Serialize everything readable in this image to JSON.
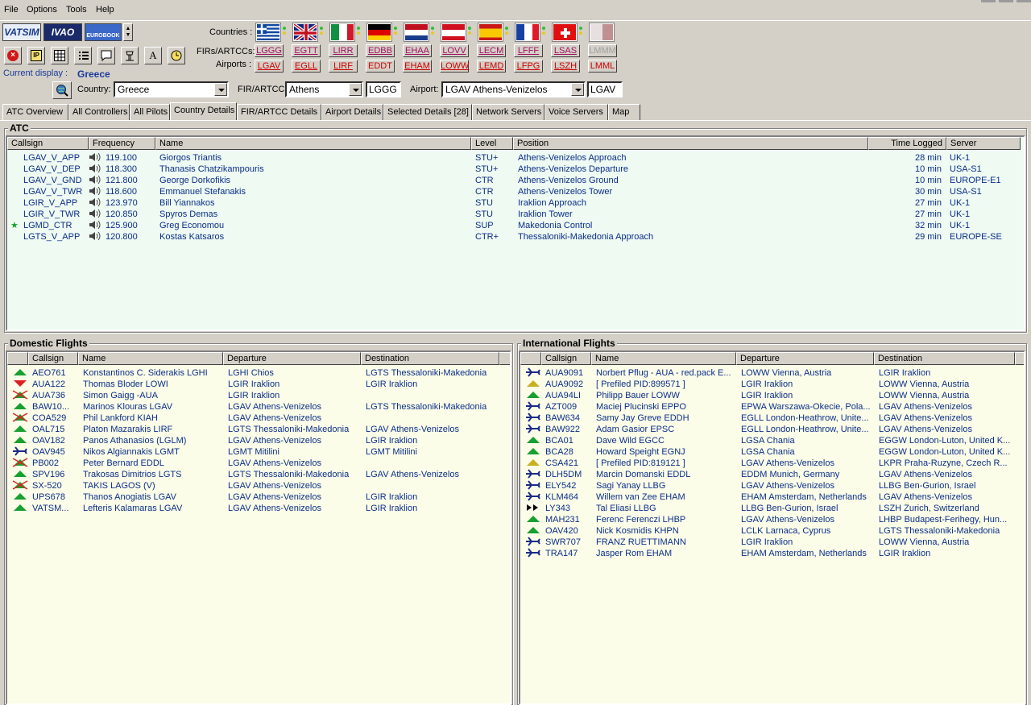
{
  "menu": [
    "File",
    "Options",
    "Tools",
    "Help"
  ],
  "logos": {
    "vatsim": "VATSIM",
    "ivao": "IVAO",
    "eurobook": "EUROBOOK"
  },
  "labels": {
    "countries": "Countries :",
    "firs": "FIRs/ARTCCs:",
    "airports": "Airports :",
    "current_display": "Current display :",
    "current_value": "Greece",
    "country": "Country:",
    "fir": "FIR/ARTCC:",
    "airport": "Airport:"
  },
  "firs": [
    "LGGG",
    "EGTT",
    "LIRR",
    "EDBB",
    "EHAA",
    "LOVV",
    "LECM",
    "LFFF",
    "LSAS",
    "LMMM"
  ],
  "airports": [
    "LGAV",
    "EGLL",
    "LIRF",
    "EDDT",
    "EHAM",
    "LOWW",
    "LEMD",
    "LFPG",
    "LSZH",
    "LMML"
  ],
  "selectors": {
    "country": "Greece",
    "fir": "Athens",
    "fir_code": "LGGG",
    "airport": "LGAV Athens-Venizelos",
    "airport_code": "LGAV"
  },
  "tabs": [
    "ATC Overview",
    "All Controllers",
    "All Pilots",
    "Country Details",
    "FIR/ARTCC Details",
    "Airport Details",
    "Selected Details [28]",
    "Network Servers",
    "Voice Servers",
    "Map"
  ],
  "atc": {
    "title": "ATC",
    "headers": [
      "Callsign",
      "Frequency",
      "Name",
      "Level",
      "Position",
      "Time Logged",
      "Server"
    ],
    "rows": [
      {
        "star": "",
        "callsign": "LGAV_V_APP",
        "freq": "119.100",
        "name": "Giorgos Triantis",
        "level": "STU+",
        "position": "Athens-Venizelos Approach",
        "time": "28 min",
        "server": "UK-1"
      },
      {
        "star": "",
        "callsign": "LGAV_V_DEP",
        "freq": "118.300",
        "name": "Thanasis Chatzikampouris",
        "level": "STU+",
        "position": "Athens-Venizelos Departure",
        "time": "10 min",
        "server": "USA-S1"
      },
      {
        "star": "",
        "callsign": "LGAV_V_GND",
        "freq": "121.800",
        "name": "George Dorkofikis",
        "level": "CTR",
        "position": "Athens-Venizelos Ground",
        "time": "10 min",
        "server": "EUROPE-E1"
      },
      {
        "star": "",
        "callsign": "LGAV_V_TWR",
        "freq": "118.600",
        "name": "Emmanuel Stefanakis",
        "level": "CTR",
        "position": "Athens-Venizelos Tower",
        "time": "30 min",
        "server": "USA-S1"
      },
      {
        "star": "",
        "callsign": "LGIR_V_APP",
        "freq": "123.970",
        "name": "Bill Yiannakos",
        "level": "STU",
        "position": "Iraklion Approach",
        "time": "27 min",
        "server": "UK-1"
      },
      {
        "star": "",
        "callsign": "LGIR_V_TWR",
        "freq": "120.850",
        "name": "Spyros Demas",
        "level": "STU",
        "position": "Iraklion Tower",
        "time": "27 min",
        "server": "UK-1"
      },
      {
        "star": "★",
        "callsign": "LGMD_CTR",
        "freq": "125.900",
        "name": "Greg Economou",
        "level": "SUP",
        "position": "Makedonia Control",
        "time": "32 min",
        "server": "UK-1"
      },
      {
        "star": "",
        "callsign": "LGTS_V_APP",
        "freq": "120.800",
        "name": "Kostas Katsaros",
        "level": "CTR+",
        "position": "Thessaloniki-Makedonia Approach",
        "time": "29 min",
        "server": "EUROPE-SE"
      }
    ]
  },
  "domestic": {
    "title": "Domestic Flights",
    "headers": [
      "Callsign",
      "Name",
      "Departure",
      "Destination"
    ],
    "rows": [
      {
        "icon": "up",
        "callsign": "AEO761",
        "name": "Konstantinos C. Siderakis LGHI",
        "dep": "LGHI Chios",
        "dest": "LGTS Thessaloniki-Makedonia"
      },
      {
        "icon": "down",
        "callsign": "AUA122",
        "name": "Thomas Bloder LOWI",
        "dep": "LGIR Iraklion",
        "dest": "LGIR Iraklion"
      },
      {
        "icon": "crossed",
        "callsign": "AUA736",
        "name": "Simon Gaigg -AUA",
        "dep": "LGIR Iraklion",
        "dest": ""
      },
      {
        "icon": "up",
        "callsign": "BAW10...",
        "name": "Marinos Klouras LGAV",
        "dep": "LGAV Athens-Venizelos",
        "dest": "LGTS Thessaloniki-Makedonia"
      },
      {
        "icon": "crossed",
        "callsign": "COA529",
        "name": "Phil Lankford KIAH",
        "dep": "LGAV Athens-Venizelos",
        "dest": ""
      },
      {
        "icon": "up",
        "callsign": "OAL715",
        "name": "Platon Mazarakis LIRF",
        "dep": "LGTS Thessaloniki-Makedonia",
        "dest": "LGAV Athens-Venizelos"
      },
      {
        "icon": "up",
        "callsign": "OAV182",
        "name": "Panos Athanasios (LGLM)",
        "dep": "LGAV Athens-Venizelos",
        "dest": "LGIR Iraklion"
      },
      {
        "icon": "plane",
        "callsign": "OAV945",
        "name": "Nikos Algiannakis LGMT",
        "dep": "LGMT Mitilini",
        "dest": "LGMT Mitilini"
      },
      {
        "icon": "crossed",
        "callsign": "PB002",
        "name": "Peter Bernard EDDL",
        "dep": "LGAV Athens-Venizelos",
        "dest": ""
      },
      {
        "icon": "up",
        "callsign": "SPV196",
        "name": "Trakosas Dimitrios LGTS",
        "dep": "LGTS Thessaloniki-Makedonia",
        "dest": "LGAV Athens-Venizelos"
      },
      {
        "icon": "crossed",
        "callsign": "SX-520",
        "name": "TAKIS LAGOS (V)",
        "dep": "LGAV Athens-Venizelos",
        "dest": ""
      },
      {
        "icon": "up",
        "callsign": "UPS678",
        "name": "Thanos Anogiatis LGAV",
        "dep": "LGAV Athens-Venizelos",
        "dest": "LGIR Iraklion"
      },
      {
        "icon": "up",
        "callsign": "VATSM...",
        "name": "Lefteris Kalamaras LGAV",
        "dep": "LGAV Athens-Venizelos",
        "dest": "LGIR Iraklion"
      }
    ]
  },
  "international": {
    "title": "International Flights",
    "headers": [
      "Callsign",
      "Name",
      "Departure",
      "Destination"
    ],
    "rows": [
      {
        "icon": "plane",
        "callsign": "AUA9091",
        "name": "Norbert Pflug - AUA - red.pack E...",
        "dep": "LOWW Vienna, Austria",
        "dest": "LGIR Iraklion"
      },
      {
        "icon": "upyellow",
        "callsign": "AUA9092",
        "name": "[ Prefiled PID:899571 ]",
        "dep": "LGIR Iraklion",
        "dest": "LOWW Vienna, Austria"
      },
      {
        "icon": "up",
        "callsign": "AUA94LI",
        "name": "Philipp Bauer LOWW",
        "dep": "LGIR Iraklion",
        "dest": "LOWW Vienna, Austria"
      },
      {
        "icon": "plane",
        "callsign": "AZT009",
        "name": "Maciej Plucinski EPPO",
        "dep": "EPWA Warszawa-Okecie, Pola...",
        "dest": "LGAV Athens-Venizelos"
      },
      {
        "icon": "plane",
        "callsign": "BAW634",
        "name": "Samy Jay Greve EDDH",
        "dep": "EGLL London-Heathrow, Unite...",
        "dest": "LGAV Athens-Venizelos"
      },
      {
        "icon": "plane",
        "callsign": "BAW922",
        "name": "Adam Gasior EPSC",
        "dep": "EGLL London-Heathrow, Unite...",
        "dest": "LGAV Athens-Venizelos"
      },
      {
        "icon": "up",
        "callsign": "BCA01",
        "name": "Dave Wild EGCC",
        "dep": "LGSA Chania",
        "dest": "EGGW London-Luton, United K..."
      },
      {
        "icon": "up",
        "callsign": "BCA28",
        "name": "Howard Speight EGNJ",
        "dep": "LGSA Chania",
        "dest": "EGGW London-Luton, United K..."
      },
      {
        "icon": "upyellow",
        "callsign": "CSA421",
        "name": "[ Prefiled PID:819121 ]",
        "dep": "LGAV Athens-Venizelos",
        "dest": "LKPR Praha-Ruzyne, Czech R..."
      },
      {
        "icon": "plane",
        "callsign": "DLH5DM",
        "name": "Marcin Domanski EDDL",
        "dep": "EDDM Munich, Germany",
        "dest": "LGAV Athens-Venizelos"
      },
      {
        "icon": "plane",
        "callsign": "ELY542",
        "name": "Sagi Yanay LLBG",
        "dep": "LGAV Athens-Venizelos",
        "dest": "LLBG Ben-Gurion, Israel"
      },
      {
        "icon": "plane",
        "callsign": "KLM464",
        "name": "Willem van Zee EHAM",
        "dep": "EHAM Amsterdam, Netherlands",
        "dest": "LGAV Athens-Venizelos"
      },
      {
        "icon": "fast",
        "callsign": "LY343",
        "name": "Tal Eliasi LLBG",
        "dep": "LLBG Ben-Gurion, Israel",
        "dest": "LSZH Zurich, Switzerland"
      },
      {
        "icon": "up",
        "callsign": "MAH231",
        "name": "Ferenc Ferenczi LHBP",
        "dep": "LGAV Athens-Venizelos",
        "dest": "LHBP Budapest-Ferihegy, Hun..."
      },
      {
        "icon": "up",
        "callsign": "OAV420",
        "name": "Nick Kosmidis KHPN",
        "dep": "LCLK Larnaca, Cyprus",
        "dest": "LGTS Thessaloniki-Makedonia"
      },
      {
        "icon": "plane",
        "callsign": "SWR707",
        "name": "FRANZ RUETTIMANN",
        "dep": "LGIR Iraklion",
        "dest": "LOWW Vienna, Austria"
      },
      {
        "icon": "plane",
        "callsign": "TRA147",
        "name": "Jasper Rom EHAM",
        "dep": "EHAM Amsterdam, Netherlands",
        "dest": "LGIR Iraklion"
      }
    ]
  },
  "colors": {
    "list_text": "#0a2e8a",
    "atc_bg": "#eefaf2",
    "flights_bg": "#fcfde8",
    "fir_code": "#a01060"
  }
}
